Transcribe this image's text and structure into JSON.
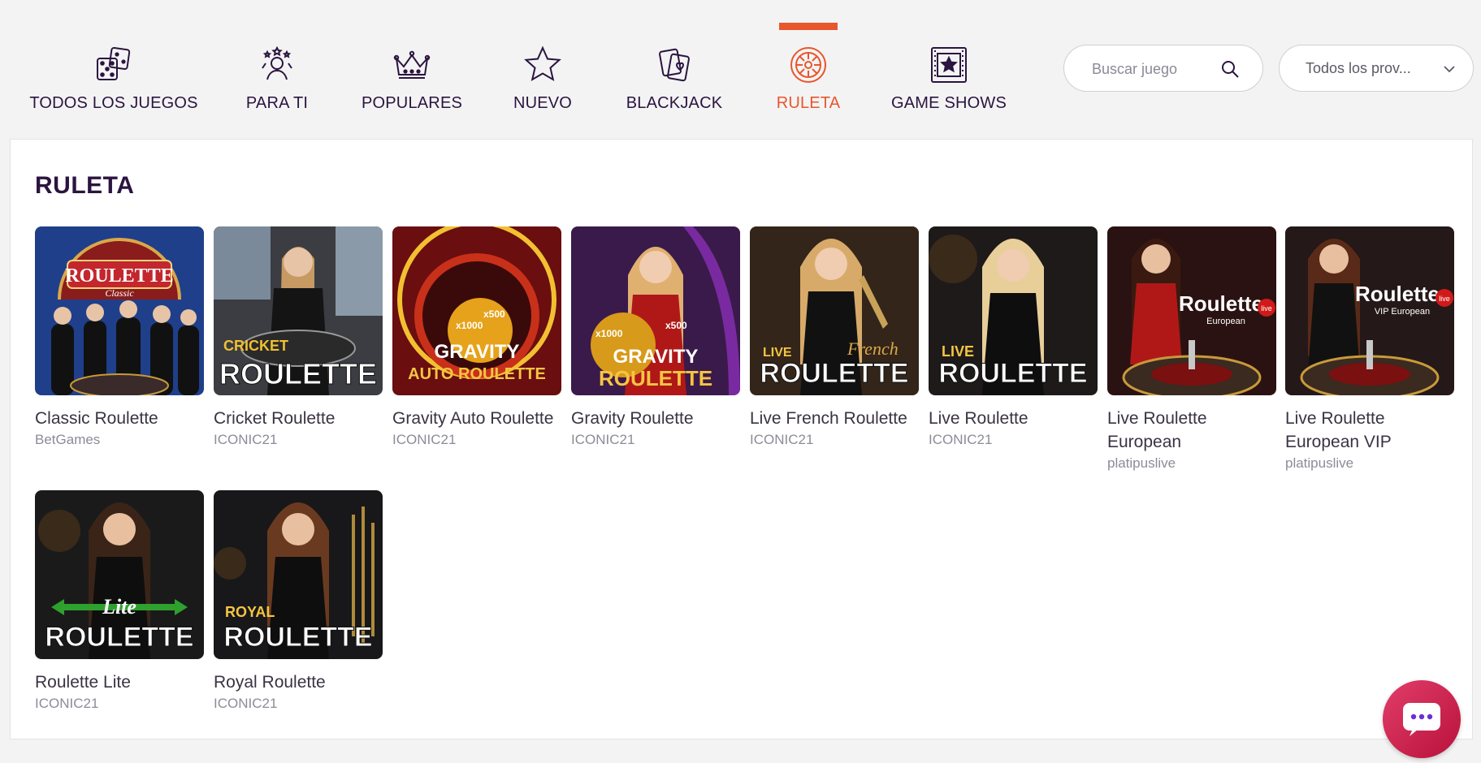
{
  "nav": {
    "tabs": [
      {
        "label": "TODOS LOS JUEGOS",
        "icon": "dice-icon",
        "active": false
      },
      {
        "label": "PARA TI",
        "icon": "user-star-icon",
        "active": false
      },
      {
        "label": "POPULARES",
        "icon": "crown-icon",
        "active": false
      },
      {
        "label": "NUEVO",
        "icon": "star-icon",
        "active": false
      },
      {
        "label": "BLACKJACK",
        "icon": "cards-icon",
        "active": false
      },
      {
        "label": "RULETA",
        "icon": "roulette-icon",
        "active": true
      },
      {
        "label": "GAME SHOWS",
        "icon": "film-star-icon",
        "active": false
      }
    ],
    "search_placeholder": "Buscar juego",
    "provider_select": "Todos los prov..."
  },
  "section": {
    "title": "RULETA"
  },
  "games": [
    {
      "name": "Classic Roulette",
      "provider": "BetGames",
      "thumb_text": "ROULETTE",
      "thumb_sub": "Classic",
      "bg": "#1f3f8a"
    },
    {
      "name": "Cricket Roulette",
      "provider": "ICONIC21",
      "thumb_text": "ROULETTE",
      "thumb_sub": "CRICKET",
      "bg": "#3b3d42"
    },
    {
      "name": "Gravity Auto Roulette",
      "provider": "ICONIC21",
      "thumb_text": "AUTO ROULETTE",
      "thumb_sub": "GRAVITY",
      "bg": "#6a0e10"
    },
    {
      "name": "Gravity Roulette",
      "provider": "ICONIC21",
      "thumb_text": "ROULETTE",
      "thumb_sub": "GRAVITY",
      "bg": "#3a1a4a"
    },
    {
      "name": "Live French Roulette",
      "provider": "ICONIC21",
      "thumb_text": "ROULETTE",
      "thumb_sub": "LIVE",
      "bg": "#2a2018"
    },
    {
      "name": "Live Roulette",
      "provider": "ICONIC21",
      "thumb_text": "ROULETTE",
      "thumb_sub": "LIVE",
      "bg": "#1e1a1a"
    },
    {
      "name": "Live Roulette European",
      "provider": "platipuslive",
      "thumb_text": "Roulette",
      "thumb_sub": "European",
      "bg": "#2b1212"
    },
    {
      "name": "Live Roulette European VIP",
      "provider": "platipuslive",
      "thumb_text": "Roulette",
      "thumb_sub": "VIP European",
      "bg": "#241818"
    },
    {
      "name": "Roulette Lite",
      "provider": "ICONIC21",
      "thumb_text": "ROULETTE",
      "thumb_sub": "Lite",
      "bg": "#1a1a1a"
    },
    {
      "name": "Royal Roulette",
      "provider": "ICONIC21",
      "thumb_text": "ROULETTE",
      "thumb_sub": "ROYAL",
      "bg": "#18181a"
    }
  ],
  "colors": {
    "accent": "#e8562e",
    "text_dark": "#2b1440",
    "chat": "#d0264f"
  }
}
